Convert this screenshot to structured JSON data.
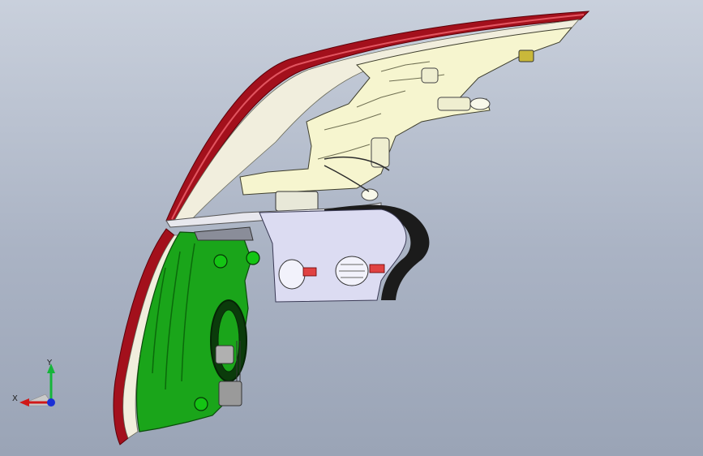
{
  "viewport": {
    "background_top": "#c9d0dc",
    "background_bottom": "#9aa4b6"
  },
  "model": {
    "parts": [
      "outer-lens",
      "reflector-housing",
      "lower-housing",
      "mounting-bracket",
      "bulb-socket",
      "wiring-harness"
    ],
    "colors": {
      "lens_red": "#a3101c",
      "lens_inner": "#f1eedd",
      "housing_cream": "#f6f5cf",
      "lower_housing_green": "#1aa51a",
      "lower_housing_dark": "#0b6a0b",
      "bracket_lavender": "#dcdcf2",
      "gasket_black": "#1b1b1b",
      "connector_red": "#e04242"
    }
  },
  "triad": {
    "y_label": "Y",
    "x_label": "X",
    "y_color": "#16b53a",
    "x_color": "#d01818",
    "z_color": "#1a2fd6"
  }
}
